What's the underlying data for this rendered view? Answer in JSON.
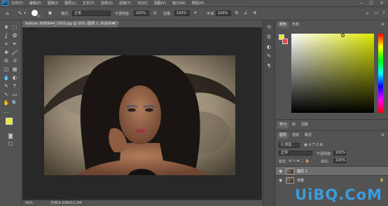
{
  "menu": {
    "logo": "Ps",
    "items": [
      "文件(F)",
      "编辑(E)",
      "图像(I)",
      "图层(L)",
      "文字(Y)",
      "选择(S)",
      "滤镜(T)",
      "3D(D)",
      "视图(V)",
      "窗口(W)",
      "帮助(H)"
    ],
    "window_controls": {
      "minimize": "—",
      "maximize": "☐",
      "close": "✕"
    }
  },
  "options": {
    "brush_size": "27",
    "mode_label": "模式:",
    "mode_value": "正常",
    "opacity_label": "不透明度:",
    "opacity_value": "100%",
    "flow_label": "流量:",
    "flow_value": "100%",
    "smooth_label": "平滑:",
    "smooth_value": "100%"
  },
  "tools": {
    "icons": [
      "move-icon",
      "marquee-icon",
      "lasso-icon",
      "quick-select-icon",
      "crop-icon",
      "eyedropper-icon",
      "healing-icon",
      "brush-icon",
      "stamp-icon",
      "history-brush-icon",
      "eraser-icon",
      "gradient-icon",
      "blur-icon",
      "dodge-icon",
      "pen-icon",
      "type-icon",
      "path-select-icon",
      "shape-icon",
      "hand-icon",
      "zoom-icon",
      "more-icon"
    ],
    "glyphs": [
      "✥",
      "⬚",
      "ʆ",
      "✪",
      "⌗",
      "✒",
      "✚",
      "🖌",
      "✇",
      "↺",
      "◫",
      "▦",
      "💧",
      "◐",
      "✎",
      "T",
      "↖",
      "▭",
      "✋",
      "🔍",
      "…"
    ]
  },
  "document": {
    "tab_title": "fashion-3080644_1920.jpg @ 50% (图层 1, RGB/8#) *",
    "close": "×",
    "zoom": "50%",
    "doc_size": "文档:6.59M/13.2M",
    "status_arrow": "›"
  },
  "colors": {
    "foreground": "#e8e83a",
    "background": "#e8464b",
    "picker_hue": "#dde800"
  },
  "color_panel": {
    "tabs": [
      "颜色",
      "色板"
    ]
  },
  "learn_panel": {
    "tabs": [
      "学习",
      "库",
      "调整"
    ]
  },
  "layers_panel": {
    "tabs": [
      "图层",
      "通道",
      "路径"
    ],
    "filter_label": "Q 类型",
    "blend_mode": "正常",
    "opacity_label": "不透明度:",
    "opacity_value": "100%",
    "lock_label": "锁定:",
    "fill_label": "填充:",
    "fill_value": "100%",
    "layers": [
      {
        "name": "图层 1",
        "selected": true
      },
      {
        "name": "背景",
        "selected": false
      }
    ]
  },
  "watermark": "UiBQ.CoM"
}
